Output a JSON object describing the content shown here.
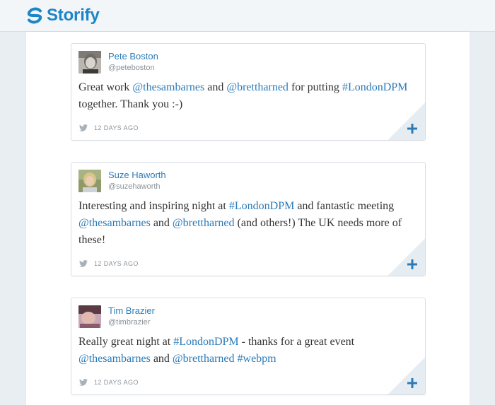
{
  "brand": {
    "name": "Storify",
    "logo_icon": "storify-logo-icon",
    "color": "#1d85c6"
  },
  "colors": {
    "link": "#2b7bb9",
    "text": "#333333",
    "meta": "#8a9299",
    "background": "#e9eef3"
  },
  "tweets": [
    {
      "author": "Pete Boston",
      "handle": "@peteboston",
      "text": [
        {
          "t": "Great work ",
          "link": false
        },
        {
          "t": "@thesambarnes",
          "link": true
        },
        {
          "t": " and ",
          "link": false
        },
        {
          "t": "@brettharned",
          "link": true
        },
        {
          "t": " for putting ",
          "link": false
        },
        {
          "t": "#LondonDPM",
          "link": true
        },
        {
          "t": " together. Thank you :-)",
          "link": false
        }
      ],
      "time": "12 DAYS AGO",
      "source_icon": "twitter-bird-icon",
      "action_icon": "plus-icon"
    },
    {
      "author": "Suze Haworth",
      "handle": "@suzehaworth",
      "text": [
        {
          "t": "Interesting and inspiring night at ",
          "link": false
        },
        {
          "t": "#LondonDPM",
          "link": true
        },
        {
          "t": " and fantastic meeting ",
          "link": false
        },
        {
          "t": "@thesambarnes",
          "link": true
        },
        {
          "t": " and ",
          "link": false
        },
        {
          "t": "@brettharned",
          "link": true
        },
        {
          "t": " (and others!) The UK needs more of these!",
          "link": false
        }
      ],
      "time": "12 DAYS AGO",
      "source_icon": "twitter-bird-icon",
      "action_icon": "plus-icon"
    },
    {
      "author": "Tim Brazier",
      "handle": "@timbrazier",
      "text": [
        {
          "t": "Really great night at ",
          "link": false
        },
        {
          "t": "#LondonDPM",
          "link": true
        },
        {
          "t": " - thanks for a great event ",
          "link": false
        },
        {
          "t": "@thesambarnes",
          "link": true
        },
        {
          "t": " and ",
          "link": false
        },
        {
          "t": "@brettharned",
          "link": true
        },
        {
          "t": " ",
          "link": false
        },
        {
          "t": "#webpm",
          "link": true
        }
      ],
      "time": "12 DAYS AGO",
      "source_icon": "twitter-bird-icon",
      "action_icon": "plus-icon"
    }
  ]
}
